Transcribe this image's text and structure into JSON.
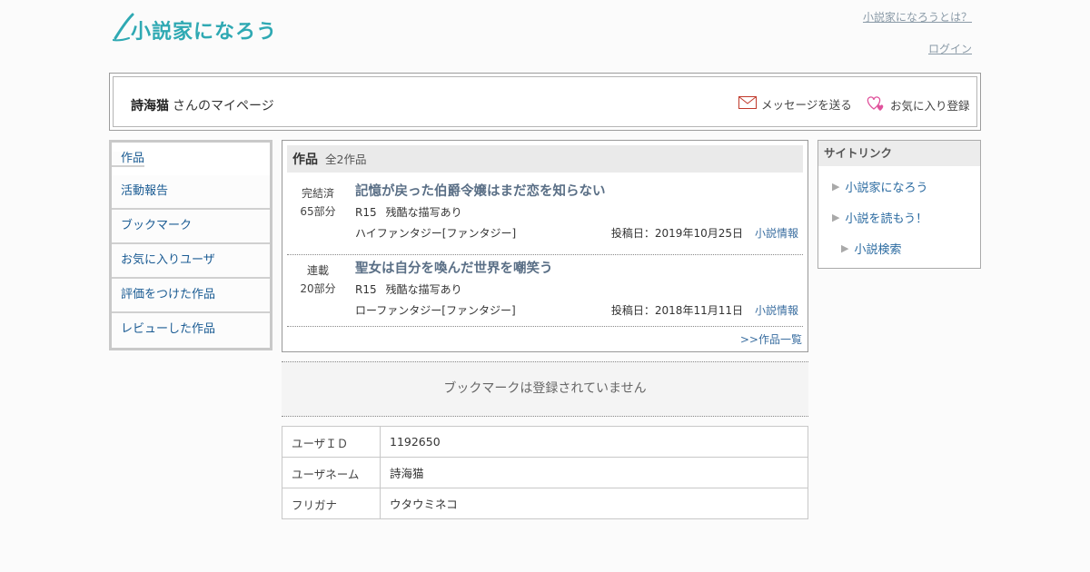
{
  "header": {
    "logo_text": "小説家になろう",
    "about_link": "小説家になろうとは？",
    "login_link": "ログイン"
  },
  "mypage": {
    "user_name": "詩海猫",
    "suffix": "さんのマイページ",
    "send_message": "メッセージを送る",
    "add_favorite": "お気に入り登録"
  },
  "left_menu": {
    "items": [
      {
        "label": "作品"
      },
      {
        "label": "活動報告"
      },
      {
        "label": "ブックマーク"
      },
      {
        "label": "お気に入りユーザ"
      },
      {
        "label": "評価をつけた作品"
      },
      {
        "label": "レビューした作品"
      }
    ]
  },
  "works": {
    "heading": "作品",
    "count_label": "全2作品",
    "items": [
      {
        "status": "完結済",
        "parts": "65部分",
        "title": "記憶が戻った伯爵令嬢はまだ恋を知らない",
        "rating": "R15",
        "warning": "残酷な描写あり",
        "genre": "ハイファンタジー[ファンタジー]",
        "posted": "投稿日：2019年10月25日",
        "info_link": "小説情報"
      },
      {
        "status": "連載",
        "parts": "20部分",
        "title": "聖女は自分を喚んだ世界を嘲笑う",
        "rating": "R15",
        "warning": "残酷な描写あり",
        "genre": "ローファンタジー[ファンタジー]",
        "posted": "投稿日：2018年11月11日",
        "info_link": "小説情報"
      }
    ],
    "more_link": ">>作品一覧"
  },
  "bookmark": {
    "empty_text": "ブックマークは登録されていません"
  },
  "user_info": {
    "rows": [
      {
        "key": "ユーザＩＤ",
        "value": "1192650"
      },
      {
        "key": "ユーザネーム",
        "value": "詩海猫"
      },
      {
        "key": "フリガナ",
        "value": "ウタウミネコ"
      }
    ]
  },
  "site_links": {
    "heading": "サイトリンク",
    "items": [
      {
        "label": "小説家になろう"
      },
      {
        "label": "小説を読もう！"
      },
      {
        "label": "小説検索"
      }
    ]
  },
  "colors": {
    "logo": "#2fa9b3",
    "link_blue": "#1a5b93",
    "work_title": "#5a6f86",
    "mail_icon": "#c0392b",
    "heart_icon": "#e0529c"
  }
}
